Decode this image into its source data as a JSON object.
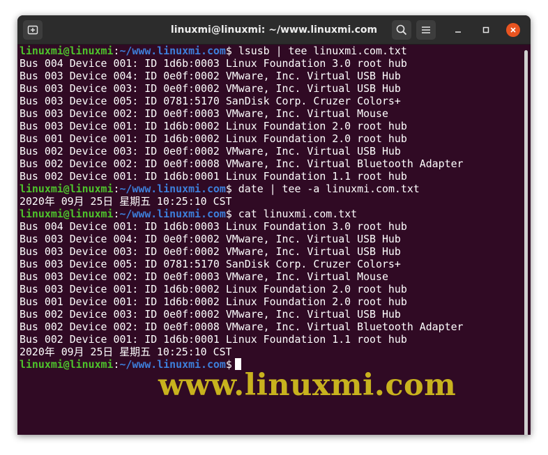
{
  "window": {
    "title": "linuxmi@linuxmi: ~/www.linuxmi.com",
    "icons": {
      "new_tab": "new-tab-icon",
      "search": "search-icon",
      "menu": "hamburger-menu-icon",
      "minimize": "minimize-icon",
      "maximize": "maximize-icon",
      "close": "close-icon"
    },
    "colors": {
      "terminal_bg": "#300a24",
      "titlebar_bg": "#2c2c2c",
      "prompt_user": "#4ec32c",
      "prompt_path": "#3d7fdb",
      "close_button": "#e95420",
      "watermark": "#c8b21e"
    }
  },
  "prompt": {
    "user_host": "linuxmi@linuxmi",
    "colon": ":",
    "path": "~/www.linuxmi.com",
    "dollar": "$"
  },
  "terminal_lines": [
    {
      "type": "prompt",
      "cmd": " lsusb | tee linuxmi.com.txt"
    },
    {
      "type": "output",
      "text": "Bus 004 Device 001: ID 1d6b:0003 Linux Foundation 3.0 root hub"
    },
    {
      "type": "output",
      "text": "Bus 003 Device 004: ID 0e0f:0002 VMware, Inc. Virtual USB Hub"
    },
    {
      "type": "output",
      "text": "Bus 003 Device 003: ID 0e0f:0002 VMware, Inc. Virtual USB Hub"
    },
    {
      "type": "output",
      "text": "Bus 003 Device 005: ID 0781:5170 SanDisk Corp. Cruzer Colors+"
    },
    {
      "type": "output",
      "text": "Bus 003 Device 002: ID 0e0f:0003 VMware, Inc. Virtual Mouse"
    },
    {
      "type": "output",
      "text": "Bus 003 Device 001: ID 1d6b:0002 Linux Foundation 2.0 root hub"
    },
    {
      "type": "output",
      "text": "Bus 001 Device 001: ID 1d6b:0002 Linux Foundation 2.0 root hub"
    },
    {
      "type": "output",
      "text": "Bus 002 Device 003: ID 0e0f:0002 VMware, Inc. Virtual USB Hub"
    },
    {
      "type": "output",
      "text": "Bus 002 Device 002: ID 0e0f:0008 VMware, Inc. Virtual Bluetooth Adapter"
    },
    {
      "type": "output",
      "text": "Bus 002 Device 001: ID 1d6b:0001 Linux Foundation 1.1 root hub"
    },
    {
      "type": "prompt",
      "cmd": " date | tee -a linuxmi.com.txt"
    },
    {
      "type": "output",
      "text": "2020年 09月 25日 星期五 10:25:10 CST"
    },
    {
      "type": "prompt",
      "cmd": " cat linuxmi.com.txt"
    },
    {
      "type": "output",
      "text": "Bus 004 Device 001: ID 1d6b:0003 Linux Foundation 3.0 root hub"
    },
    {
      "type": "output",
      "text": "Bus 003 Device 004: ID 0e0f:0002 VMware, Inc. Virtual USB Hub"
    },
    {
      "type": "output",
      "text": "Bus 003 Device 003: ID 0e0f:0002 VMware, Inc. Virtual USB Hub"
    },
    {
      "type": "output",
      "text": "Bus 003 Device 005: ID 0781:5170 SanDisk Corp. Cruzer Colors+"
    },
    {
      "type": "output",
      "text": "Bus 003 Device 002: ID 0e0f:0003 VMware, Inc. Virtual Mouse"
    },
    {
      "type": "output",
      "text": "Bus 003 Device 001: ID 1d6b:0002 Linux Foundation 2.0 root hub"
    },
    {
      "type": "output",
      "text": "Bus 001 Device 001: ID 1d6b:0002 Linux Foundation 2.0 root hub"
    },
    {
      "type": "output",
      "text": "Bus 002 Device 003: ID 0e0f:0002 VMware, Inc. Virtual USB Hub"
    },
    {
      "type": "output",
      "text": "Bus 002 Device 002: ID 0e0f:0008 VMware, Inc. Virtual Bluetooth Adapter"
    },
    {
      "type": "output",
      "text": "Bus 002 Device 001: ID 1d6b:0001 Linux Foundation 1.1 root hub"
    },
    {
      "type": "output",
      "text": "2020年 09月 25日 星期五 10:25:10 CST"
    },
    {
      "type": "prompt",
      "cmd": "",
      "cursor": true
    }
  ],
  "watermark": "www.linuxmi.com"
}
